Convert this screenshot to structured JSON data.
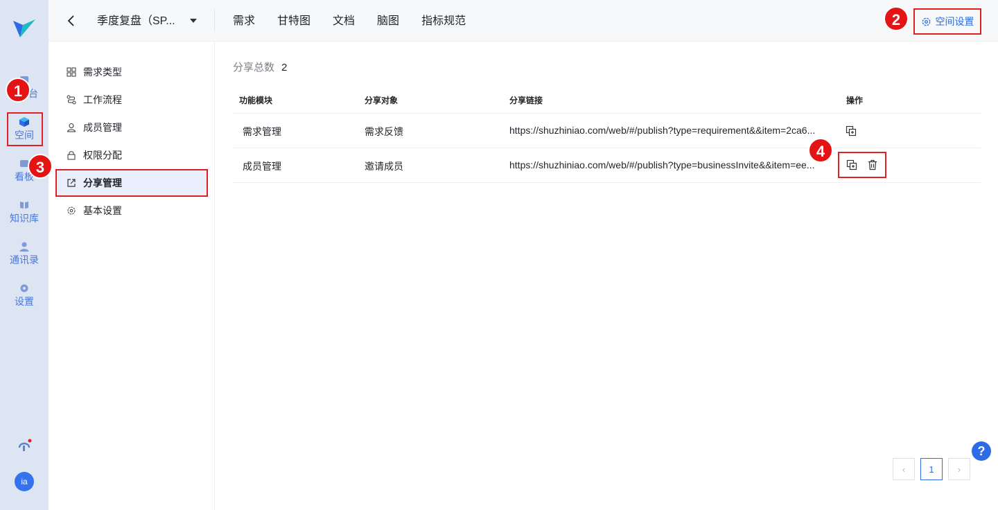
{
  "rail": {
    "items": [
      {
        "label": "台",
        "icon": "workbench-icon"
      },
      {
        "label": "空间",
        "icon": "cube-icon"
      },
      {
        "label": "看板",
        "icon": "board-icon"
      },
      {
        "label": "知识库",
        "icon": "book-icon"
      },
      {
        "label": "通讯录",
        "icon": "user-icon"
      },
      {
        "label": "设置",
        "icon": "gear-icon"
      }
    ],
    "avatar": "ia"
  },
  "topbar": {
    "space_name": "季度复盘（SP...",
    "tabs": [
      "需求",
      "甘特图",
      "文档",
      "脑图",
      "指标规范"
    ],
    "settings_label": "空间设置"
  },
  "subnav": {
    "items": [
      "需求类型",
      "工作流程",
      "成员管理",
      "权限分配",
      "分享管理",
      "基本设置"
    ],
    "active": "分享管理"
  },
  "content": {
    "total_label": "分享总数",
    "total_value": "2",
    "columns": [
      "功能模块",
      "分享对象",
      "分享链接",
      "操作"
    ],
    "rows": [
      {
        "module": "需求管理",
        "target": "需求反馈",
        "link": "https://shuzhiniao.com/web/#/publish?type=requirement&&item=2ca6..."
      },
      {
        "module": "成员管理",
        "target": "邀请成员",
        "link": "https://shuzhiniao.com/web/#/publish?type=businessInvite&&item=ee..."
      }
    ]
  },
  "pager": {
    "prev": "‹",
    "current": "1",
    "next": "›"
  },
  "help": "?",
  "markers": [
    "1",
    "2",
    "3",
    "4"
  ],
  "colors": {
    "accent": "#2e6be6",
    "annotation": "#e02020",
    "rail_bg": "#dde4f2"
  }
}
